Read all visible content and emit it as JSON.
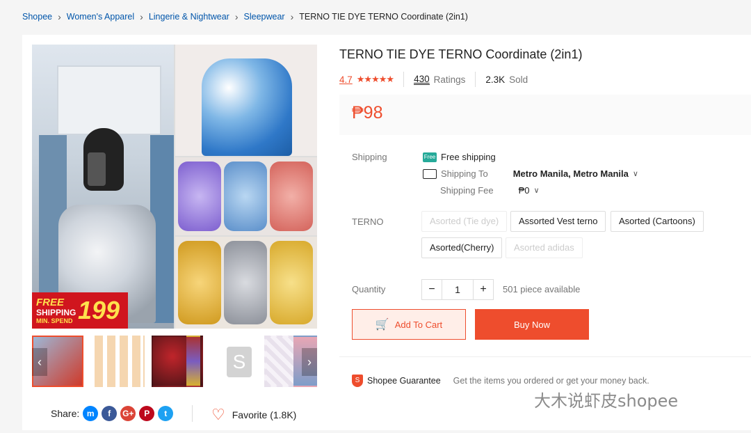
{
  "breadcrumb": [
    {
      "label": "Shopee"
    },
    {
      "label": "Women's Apparel"
    },
    {
      "label": "Lingerie & Nightwear"
    },
    {
      "label": "Sleepwear"
    },
    {
      "label": "TERNO TIE DYE TERNO Coordinate (2in1)"
    }
  ],
  "gallery": {
    "promo_line1": "FREE",
    "promo_line2": "SHIPPING",
    "promo_line3": "MIN. SPEND",
    "promo_value": "199",
    "thumbnail_logo_letter": "S",
    "prev_arrow": "‹",
    "next_arrow": "›"
  },
  "share": {
    "label": "Share:",
    "networks": [
      "messenger",
      "facebook",
      "google-plus",
      "pinterest",
      "twitter"
    ]
  },
  "favorite": {
    "label": "Favorite (1.8K)"
  },
  "product": {
    "title": "TERNO TIE DYE TERNO Coordinate (2in1)",
    "rating": "4.7",
    "stars": "★★★★★",
    "ratings_count": "430",
    "ratings_label": "Ratings",
    "sold_count": "2.3K",
    "sold_label": "Sold",
    "price": "₱98"
  },
  "shipping": {
    "label": "Shipping",
    "free_label": "Free shipping",
    "free_badge": "Free",
    "to_label": "Shipping To",
    "destination": "Metro Manila, Metro Manila",
    "fee_label": "Shipping Fee",
    "fee_value": "₱0"
  },
  "variation": {
    "label": "TERNO",
    "options": [
      {
        "label": "Asorted (Tie dye)",
        "disabled": true
      },
      {
        "label": "Assorted Vest terno",
        "disabled": false
      },
      {
        "label": "Asorted (Cartoons)",
        "disabled": false
      },
      {
        "label": "Asorted(Cherry)",
        "disabled": false
      },
      {
        "label": "Asorted adidas",
        "disabled": true
      }
    ]
  },
  "quantity": {
    "label": "Quantity",
    "value": "1",
    "minus": "−",
    "plus": "+",
    "available": "501 piece available"
  },
  "actions": {
    "add_to_cart": "Add To Cart",
    "buy_now": "Buy Now"
  },
  "guarantee": {
    "title": "Shopee Guarantee",
    "text": "Get the items you ordered or get your money back."
  },
  "watermark": "大木说虾皮shopee",
  "colors": {
    "accent": "#ee4d2d",
    "free_ship": "#26aa99"
  }
}
